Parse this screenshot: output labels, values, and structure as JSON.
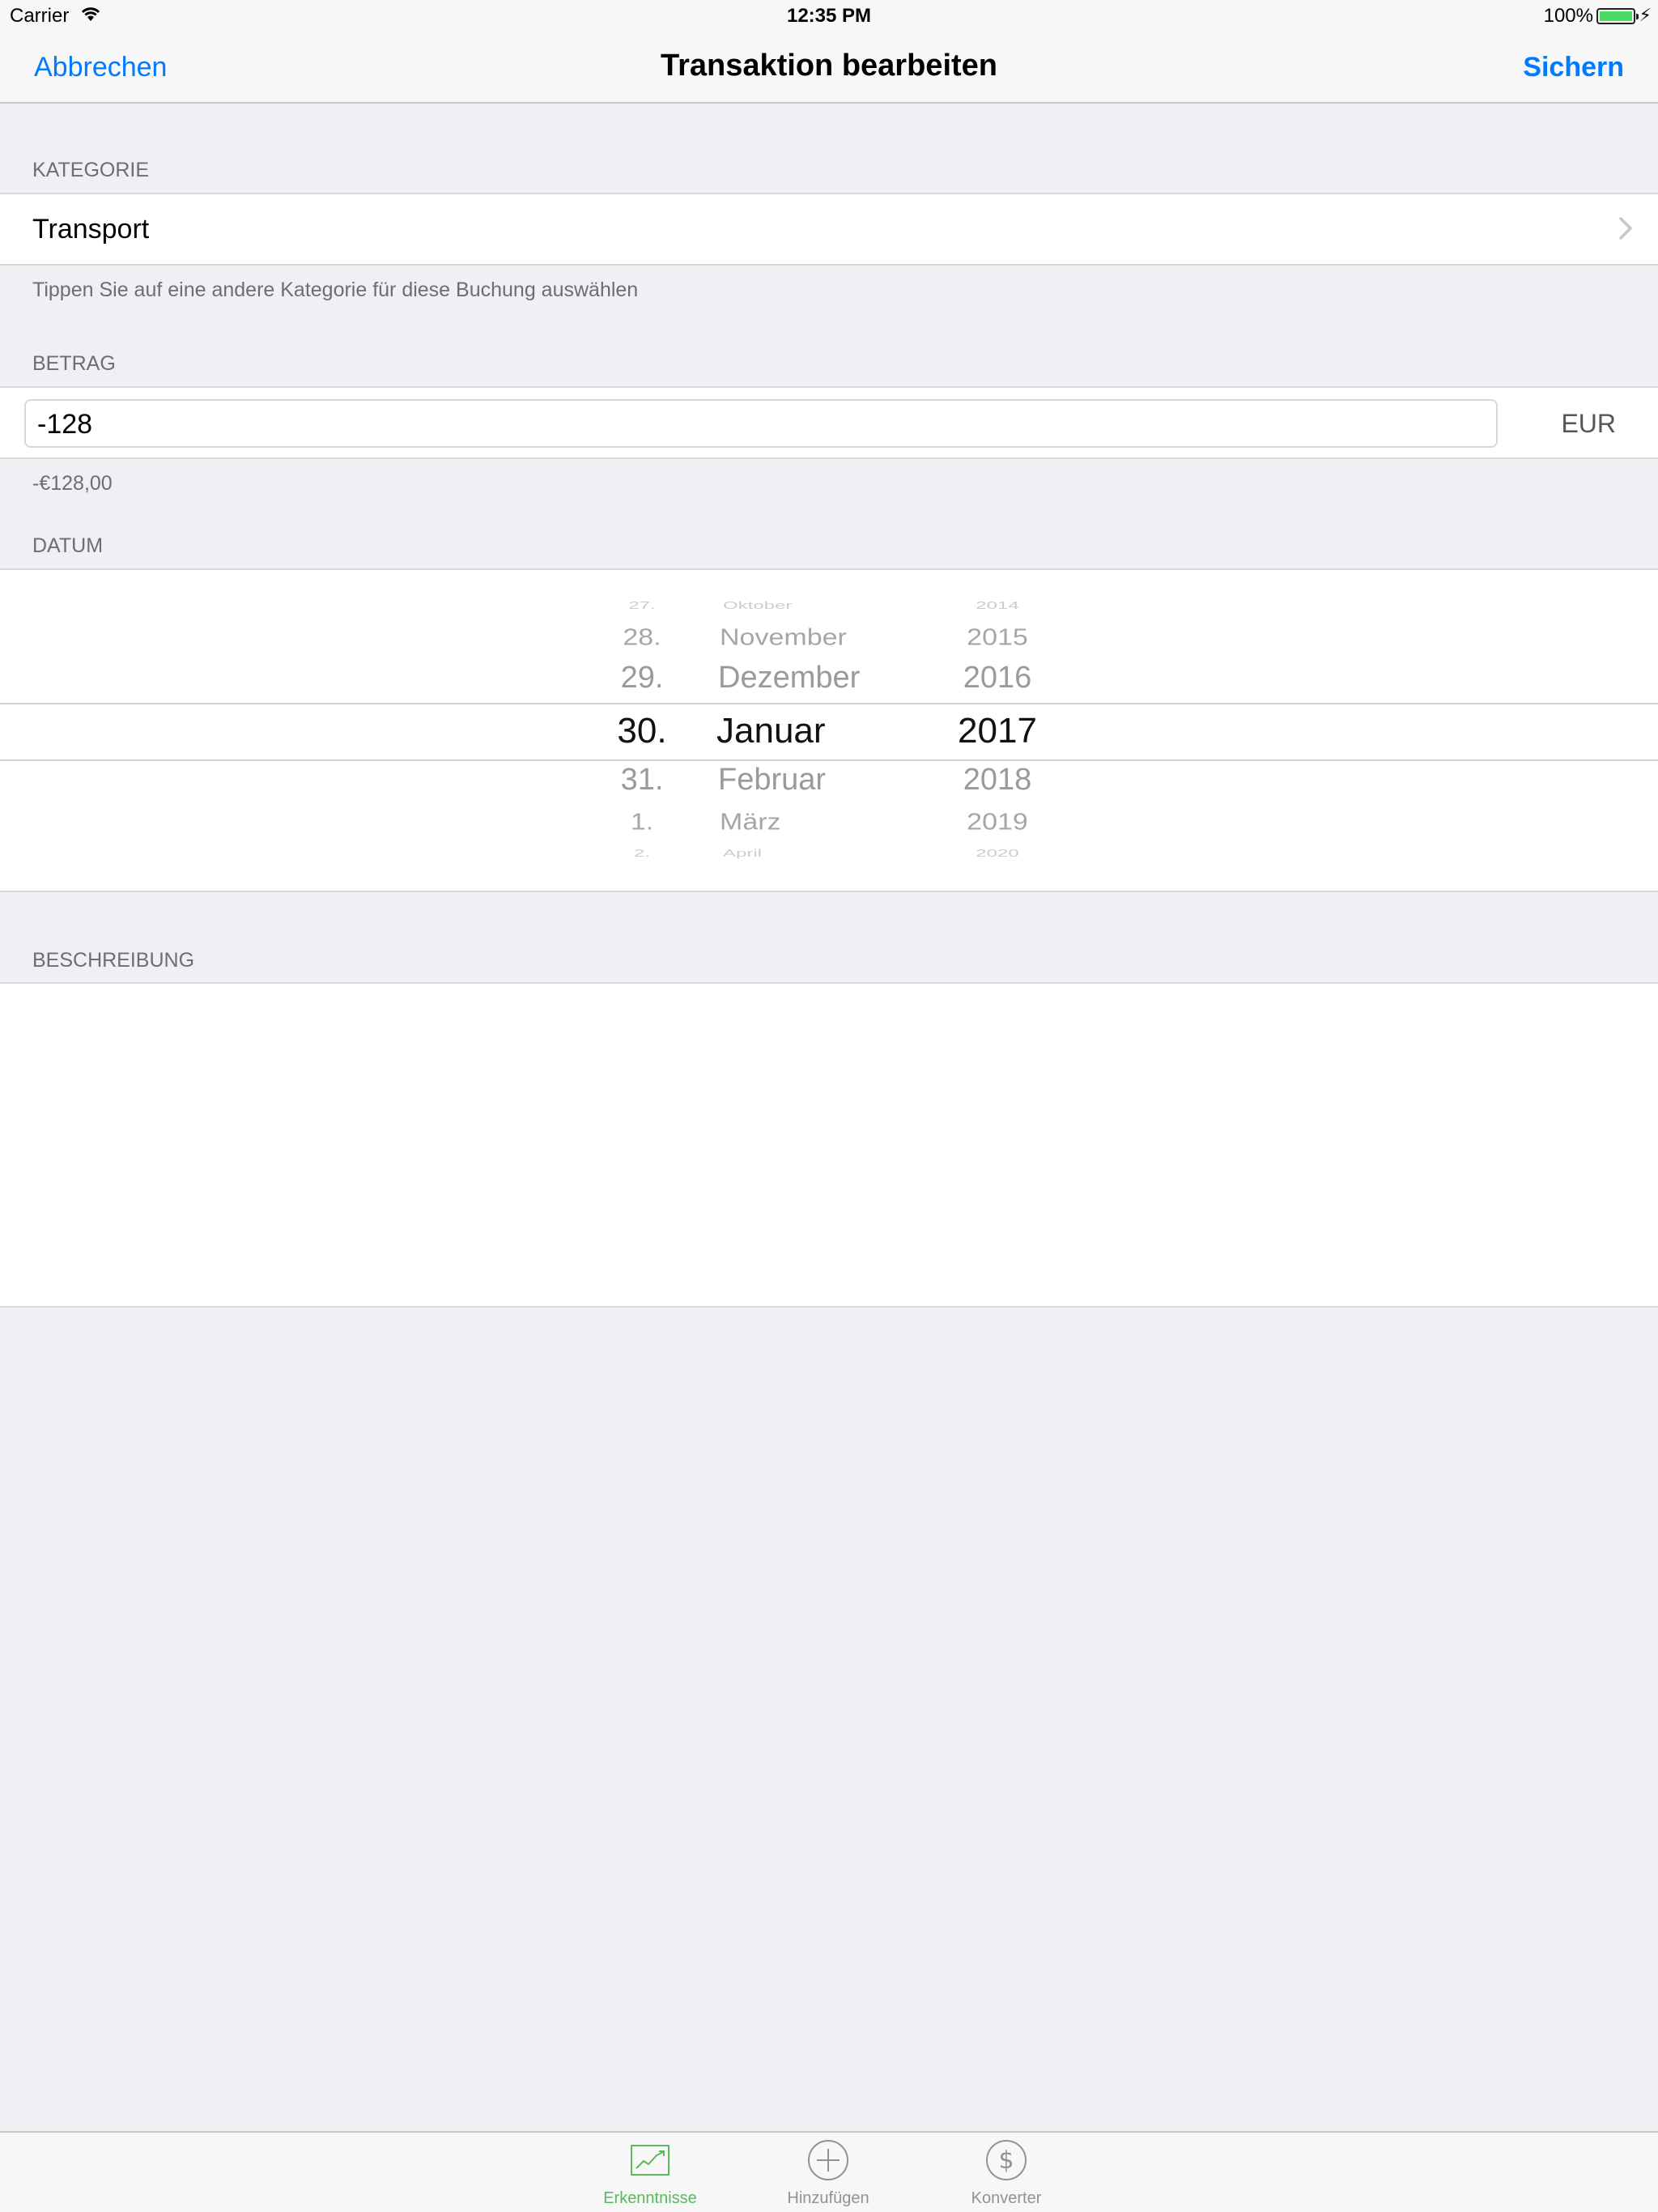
{
  "status_bar": {
    "carrier": "Carrier",
    "time": "12:35 PM",
    "battery": "100%"
  },
  "nav": {
    "cancel": "Abbrechen",
    "title": "Transaktion bearbeiten",
    "save": "Sichern"
  },
  "category": {
    "header": "KATEGORIE",
    "value": "Transport",
    "footer": "Tippen Sie auf eine andere Kategorie für diese Buchung auswählen"
  },
  "amount": {
    "header": "BETRAG",
    "value": "-128",
    "currency": "EUR",
    "formatted": "-€128,00"
  },
  "date": {
    "header": "DATUM",
    "days": [
      "27.",
      "28.",
      "29.",
      "30.",
      "31.",
      "1.",
      "2."
    ],
    "months": [
      "Oktober",
      "November",
      "Dezember",
      "Januar",
      "Februar",
      "März",
      "April"
    ],
    "years": [
      "2014",
      "2015",
      "2016",
      "2017",
      "2018",
      "2019",
      "2020"
    ]
  },
  "description": {
    "header": "BESCHREIBUNG",
    "value": ""
  },
  "tabs": [
    {
      "label": "Erkenntnisse",
      "icon": "chart-icon",
      "active": true
    },
    {
      "label": "Hinzufügen",
      "icon": "plus-circle-icon",
      "active": false
    },
    {
      "label": "Konverter",
      "icon": "dollar-circle-icon",
      "active": false
    }
  ],
  "colors": {
    "accent": "#007aff",
    "active_tab": "#5cb85c",
    "background": "#efeff4"
  }
}
